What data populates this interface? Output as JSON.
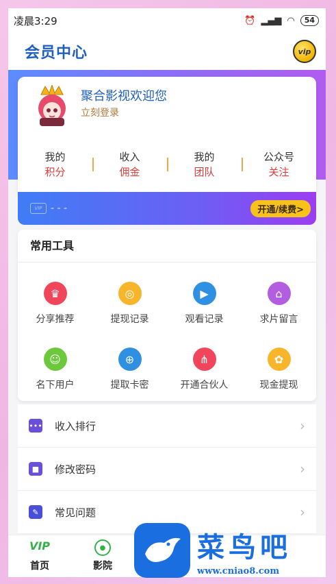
{
  "status_bar": {
    "time": "凌晨3:29",
    "battery": "54"
  },
  "header": {
    "title": "会员中心",
    "vip_badge": "vip"
  },
  "profile": {
    "welcome": "聚合影视欢迎您",
    "login": "立刻登录",
    "stats": [
      {
        "top": "我的",
        "bottom": "积分"
      },
      {
        "top": "收入",
        "bottom": "佣金"
      },
      {
        "top": "我的",
        "bottom": "团队"
      },
      {
        "top": "公众号",
        "bottom": "关注"
      }
    ]
  },
  "vip_strip": {
    "card_label": "VIP",
    "status": "- - -",
    "renew": "开通/续费>"
  },
  "tools": {
    "title": "常用工具",
    "items": [
      {
        "label": "分享推荐",
        "icon": "crown-icon",
        "color": "#f0455a"
      },
      {
        "label": "提现记录",
        "icon": "coins-icon",
        "color": "#f7b52b"
      },
      {
        "label": "观看记录",
        "icon": "tv-icon",
        "color": "#2f8fe0"
      },
      {
        "label": "求片留言",
        "icon": "store-icon",
        "color": "#b35ee0"
      },
      {
        "label": "名下用户",
        "icon": "user-card-icon",
        "color": "#6cc93c"
      },
      {
        "label": "提取卡密",
        "icon": "lock-icon",
        "color": "#2f8fe0"
      },
      {
        "label": "开通合伙人",
        "icon": "network-icon",
        "color": "#f0455a"
      },
      {
        "label": "现金提现",
        "icon": "gear-icon",
        "color": "#f7b52b"
      }
    ]
  },
  "list": [
    {
      "label": "收入排行",
      "icon": "chat-dots-icon",
      "color": "#6a4fd8"
    },
    {
      "label": "修改密码",
      "icon": "padlock-icon",
      "color": "#6a4fd8"
    },
    {
      "label": "常见问题",
      "icon": "edit-doc-icon",
      "color": "#4b4fd8"
    }
  ],
  "bottom_nav": [
    {
      "label": "首页",
      "icon": "vip-tab-icon"
    },
    {
      "label": "影院",
      "icon": "film-reel-icon"
    }
  ],
  "watermark": {
    "title": "菜鸟吧",
    "url": "www.cniao8.com"
  }
}
